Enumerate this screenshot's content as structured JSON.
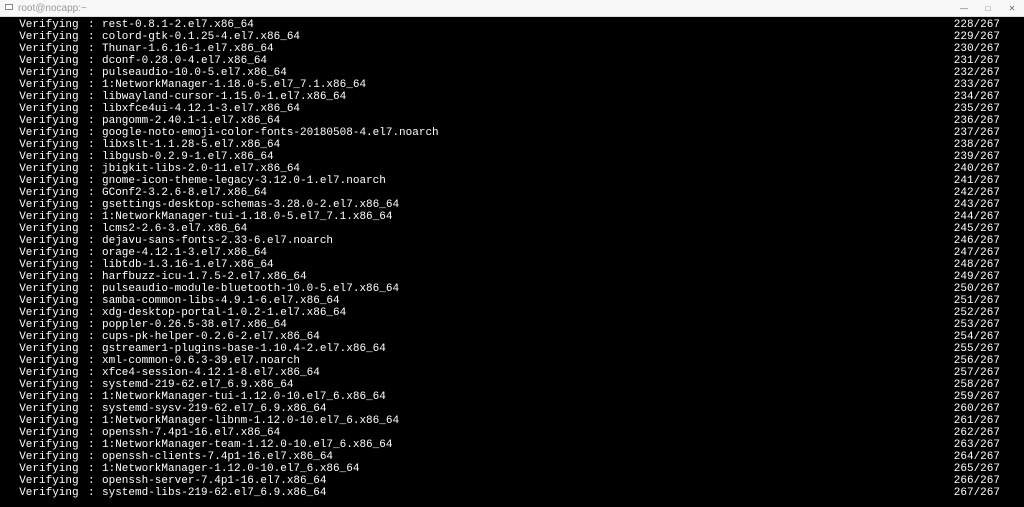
{
  "window": {
    "title": "root@nocapp:~"
  },
  "terminal": {
    "label": "Verifying",
    "colon": ":",
    "total": 267,
    "rows": [
      {
        "pkg": "rest-0.8.1-2.el7.x86_64",
        "n": 228
      },
      {
        "pkg": "colord-gtk-0.1.25-4.el7.x86_64",
        "n": 229
      },
      {
        "pkg": "Thunar-1.6.16-1.el7.x86_64",
        "n": 230
      },
      {
        "pkg": "dconf-0.28.0-4.el7.x86_64",
        "n": 231
      },
      {
        "pkg": "pulseaudio-10.0-5.el7.x86_64",
        "n": 232
      },
      {
        "pkg": "1:NetworkManager-1.18.0-5.el7_7.1.x86_64",
        "n": 233
      },
      {
        "pkg": "libwayland-cursor-1.15.0-1.el7.x86_64",
        "n": 234
      },
      {
        "pkg": "libxfce4ui-4.12.1-3.el7.x86_64",
        "n": 235
      },
      {
        "pkg": "pangomm-2.40.1-1.el7.x86_64",
        "n": 236
      },
      {
        "pkg": "google-noto-emoji-color-fonts-20180508-4.el7.noarch",
        "n": 237
      },
      {
        "pkg": "libxslt-1.1.28-5.el7.x86_64",
        "n": 238
      },
      {
        "pkg": "libgusb-0.2.9-1.el7.x86_64",
        "n": 239
      },
      {
        "pkg": "jbigkit-libs-2.0-11.el7.x86_64",
        "n": 240
      },
      {
        "pkg": "gnome-icon-theme-legacy-3.12.0-1.el7.noarch",
        "n": 241
      },
      {
        "pkg": "GConf2-3.2.6-8.el7.x86_64",
        "n": 242
      },
      {
        "pkg": "gsettings-desktop-schemas-3.28.0-2.el7.x86_64",
        "n": 243
      },
      {
        "pkg": "1:NetworkManager-tui-1.18.0-5.el7_7.1.x86_64",
        "n": 244
      },
      {
        "pkg": "lcms2-2.6-3.el7.x86_64",
        "n": 245
      },
      {
        "pkg": "dejavu-sans-fonts-2.33-6.el7.noarch",
        "n": 246
      },
      {
        "pkg": "orage-4.12.1-3.el7.x86_64",
        "n": 247
      },
      {
        "pkg": "libtdb-1.3.16-1.el7.x86_64",
        "n": 248
      },
      {
        "pkg": "harfbuzz-icu-1.7.5-2.el7.x86_64",
        "n": 249
      },
      {
        "pkg": "pulseaudio-module-bluetooth-10.0-5.el7.x86_64",
        "n": 250
      },
      {
        "pkg": "samba-common-libs-4.9.1-6.el7.x86_64",
        "n": 251
      },
      {
        "pkg": "xdg-desktop-portal-1.0.2-1.el7.x86_64",
        "n": 252
      },
      {
        "pkg": "poppler-0.26.5-38.el7.x86_64",
        "n": 253
      },
      {
        "pkg": "cups-pk-helper-0.2.6-2.el7.x86_64",
        "n": 254
      },
      {
        "pkg": "gstreamer1-plugins-base-1.10.4-2.el7.x86_64",
        "n": 255
      },
      {
        "pkg": "xml-common-0.6.3-39.el7.noarch",
        "n": 256
      },
      {
        "pkg": "xfce4-session-4.12.1-8.el7.x86_64",
        "n": 257
      },
      {
        "pkg": "systemd-219-62.el7_6.9.x86_64",
        "n": 258
      },
      {
        "pkg": "1:NetworkManager-tui-1.12.0-10.el7_6.x86_64",
        "n": 259
      },
      {
        "pkg": "systemd-sysv-219-62.el7_6.9.x86_64",
        "n": 260
      },
      {
        "pkg": "1:NetworkManager-libnm-1.12.0-10.el7_6.x86_64",
        "n": 261
      },
      {
        "pkg": "openssh-7.4p1-16.el7.x86_64",
        "n": 262
      },
      {
        "pkg": "1:NetworkManager-team-1.12.0-10.el7_6.x86_64",
        "n": 263
      },
      {
        "pkg": "openssh-clients-7.4p1-16.el7.x86_64",
        "n": 264
      },
      {
        "pkg": "1:NetworkManager-1.12.0-10.el7_6.x86_64",
        "n": 265
      },
      {
        "pkg": "openssh-server-7.4p1-16.el7.x86_64",
        "n": 266
      },
      {
        "pkg": "systemd-libs-219-62.el7_6.9.x86_64",
        "n": 267
      }
    ]
  }
}
